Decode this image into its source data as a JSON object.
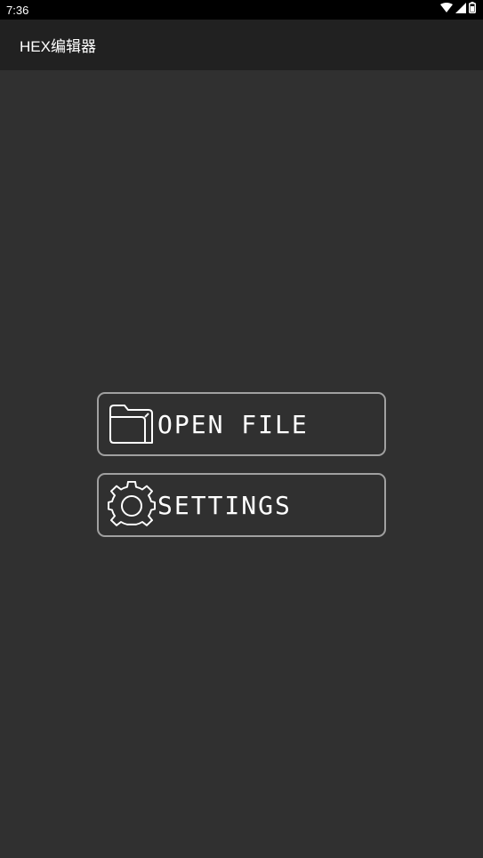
{
  "status_bar": {
    "time": "7:36",
    "icons": [
      "wifi-icon",
      "cell-signal-icon",
      "battery-icon"
    ]
  },
  "app_bar": {
    "title": "HEX编辑器"
  },
  "menu": {
    "open_file": {
      "label": "OPEN FILE",
      "icon": "folder-icon"
    },
    "settings": {
      "label": "SETTINGS",
      "icon": "gear-icon"
    }
  },
  "colors": {
    "background": "#303030",
    "app_bar": "#212121",
    "status_bar": "#000000",
    "button_border": "#a0a0a0",
    "text": "#ffffff"
  }
}
